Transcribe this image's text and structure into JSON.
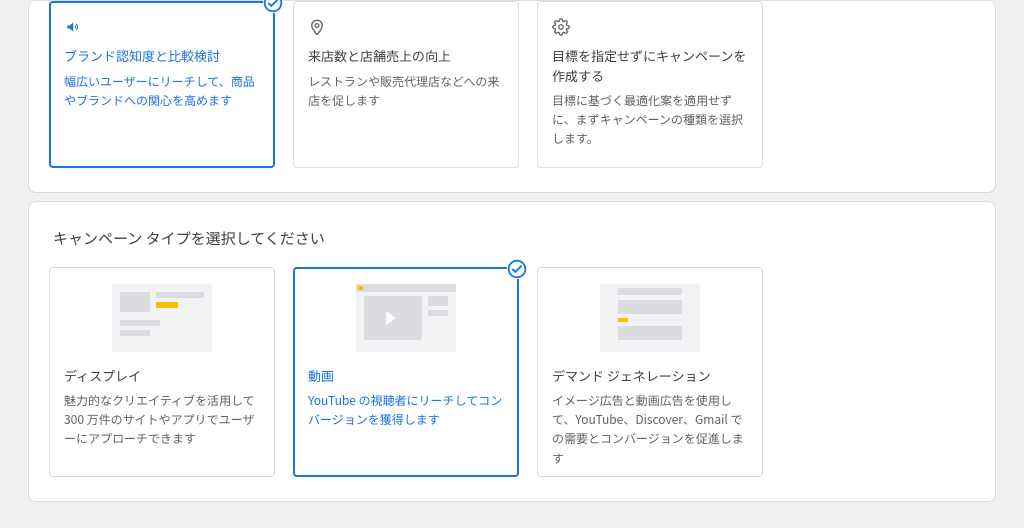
{
  "goals": {
    "brand": {
      "title": "ブランド認知度と比較検討",
      "desc": "幅広いユーザーにリーチして、商品やブランドへの関心を高めます"
    },
    "store": {
      "title": "来店数と店舗売上の向上",
      "desc": "レストランや販売代理店などへの来店を促します"
    },
    "noGoal": {
      "title": "目標を指定せずにキャンペーンを作成する",
      "desc": "目標に基づく最適化案を適用せずに、まずキャンペーンの種類を選択します。"
    }
  },
  "campaignTypeHeading": "キャンペーン タイプを選択してください",
  "types": {
    "display": {
      "title": "ディスプレイ",
      "desc": "魅力的なクリエイティブを活用して 300 万件のサイトやアプリでユーザーにアプローチできます"
    },
    "video": {
      "title": "動画",
      "desc": "YouTube の視聴者にリーチしてコンバージョンを獲得します"
    },
    "demand": {
      "title": "デマンド ジェネレーション",
      "desc": "イメージ広告と動画広告を使用して、YouTube、Discover、Gmail での需要とコンバージョンを促進します"
    }
  }
}
